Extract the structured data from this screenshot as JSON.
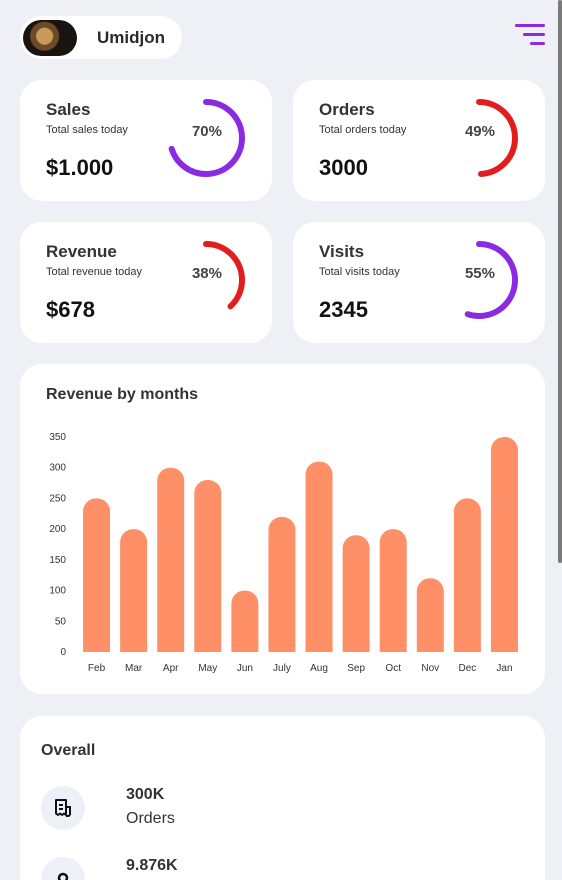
{
  "header": {
    "username": "Umidjon",
    "menu_icon": "menu-icon",
    "accent": "#8a2be2"
  },
  "stats": [
    {
      "title": "Sales",
      "subtitle": "Total sales today",
      "value": "$1.000",
      "percent_label": "70%",
      "percent": 70,
      "color": "#8a2be2"
    },
    {
      "title": "Orders",
      "subtitle": "Total orders today",
      "value": "3000",
      "percent_label": "49%",
      "percent": 49,
      "color": "#e11d1d"
    },
    {
      "title": "Revenue",
      "subtitle": "Total revenue today",
      "value": "$678",
      "percent_label": "38%",
      "percent": 38,
      "color": "#e11d1d"
    },
    {
      "title": "Visits",
      "subtitle": "Total visits today",
      "value": "2345",
      "percent_label": "55%",
      "percent": 55,
      "color": "#8a2be2"
    }
  ],
  "chart": {
    "title": "Revenue by months"
  },
  "chart_data": {
    "type": "bar",
    "title": "Revenue by months",
    "categories": [
      "Feb",
      "Mar",
      "Apr",
      "May",
      "Jun",
      "July",
      "Aug",
      "Sep",
      "Oct",
      "Nov",
      "Dec",
      "Jan"
    ],
    "values": [
      250,
      200,
      300,
      280,
      100,
      220,
      310,
      190,
      200,
      120,
      250,
      350
    ],
    "yticks": [
      0,
      50,
      100,
      150,
      200,
      250,
      300,
      350
    ],
    "ylim": [
      0,
      350
    ],
    "grid": false,
    "bar_color": "#ff8f67"
  },
  "overall": {
    "title": "Overall",
    "items": [
      {
        "value": "300K",
        "label": "Orders",
        "icon": "receipt-icon"
      },
      {
        "value": "9.876K",
        "label": "",
        "icon": "user-icon"
      }
    ]
  }
}
